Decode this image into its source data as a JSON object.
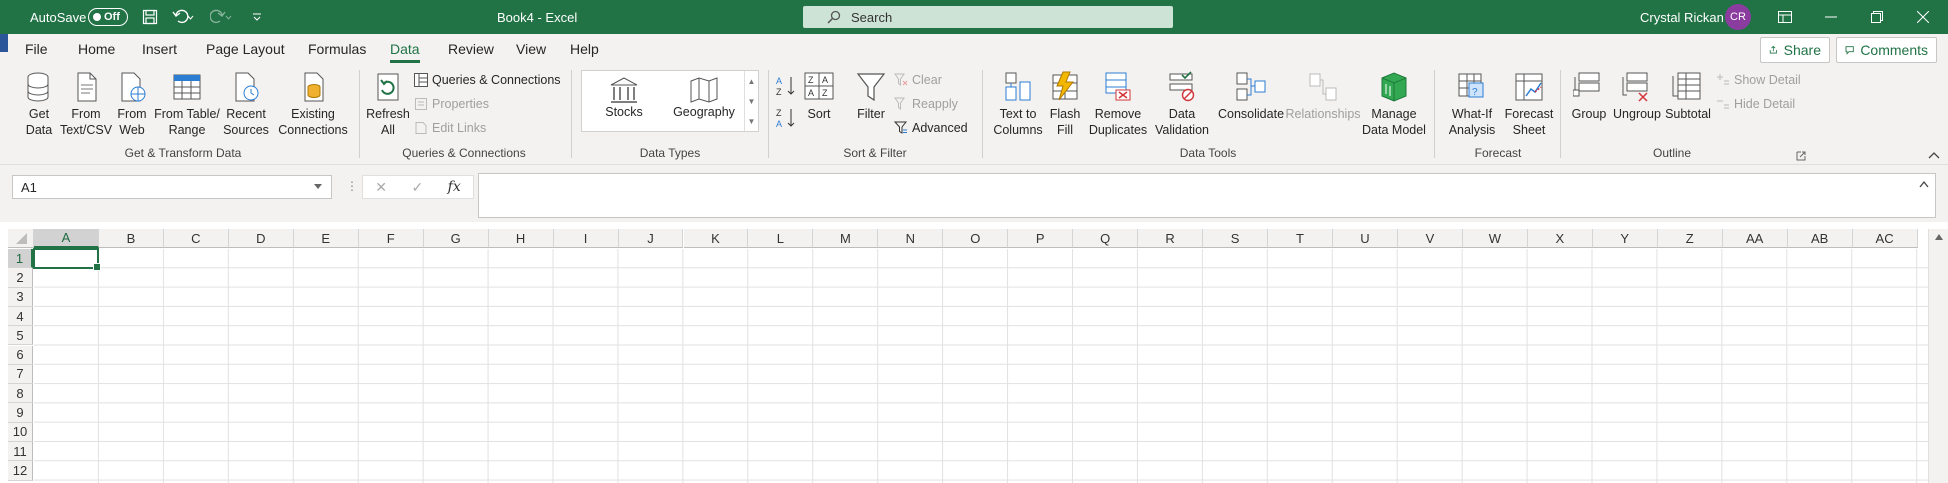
{
  "titlebar": {
    "autosave_label": "AutoSave",
    "autosave_state": "Off",
    "doc_title": "Book4  -  Excel",
    "search_placeholder": "Search",
    "user_name": "Crystal Rickan",
    "user_initials": "CR"
  },
  "tabs": [
    "File",
    "Home",
    "Insert",
    "Page Layout",
    "Formulas",
    "Data",
    "Review",
    "View",
    "Help"
  ],
  "active_tab": "Data",
  "top_buttons": {
    "share": "Share",
    "comments": "Comments"
  },
  "ribbon": {
    "get_transform": {
      "label": "Get & Transform Data",
      "get_data": [
        "Get",
        "Data"
      ],
      "from_text": [
        "From",
        "Text/CSV"
      ],
      "from_web": [
        "From",
        "Web"
      ],
      "from_table": [
        "From Table/",
        "Range"
      ],
      "recent_sources": [
        "Recent",
        "Sources"
      ],
      "existing_connections": [
        "Existing",
        "Connections"
      ]
    },
    "queries": {
      "label": "Queries & Connections",
      "refresh_all": [
        "Refresh",
        "All"
      ],
      "queries_connections": "Queries & Connections",
      "properties": "Properties",
      "edit_links": "Edit Links"
    },
    "data_types": {
      "label": "Data Types",
      "stocks": "Stocks",
      "geography": "Geography"
    },
    "sort_filter": {
      "label": "Sort & Filter",
      "sort": "Sort",
      "filter": "Filter",
      "clear": "Clear",
      "reapply": "Reapply",
      "advanced": "Advanced"
    },
    "data_tools": {
      "label": "Data Tools",
      "text_to_columns": [
        "Text to",
        "Columns"
      ],
      "flash_fill": [
        "Flash",
        "Fill"
      ],
      "remove_duplicates": [
        "Remove",
        "Duplicates"
      ],
      "data_validation": [
        "Data",
        "Validation"
      ],
      "consolidate": "Consolidate",
      "relationships": "Relationships",
      "manage_data_model": [
        "Manage",
        "Data Model"
      ]
    },
    "forecast": {
      "label": "Forecast",
      "what_if": [
        "What-If",
        "Analysis"
      ],
      "forecast_sheet": [
        "Forecast",
        "Sheet"
      ]
    },
    "outline": {
      "label": "Outline",
      "group": "Group",
      "ungroup": "Ungroup",
      "subtotal": "Subtotal",
      "show_detail": "Show Detail",
      "hide_detail": "Hide Detail"
    }
  },
  "formula_bar": {
    "name_box": "A1",
    "fx": "fx",
    "value": ""
  },
  "grid": {
    "columns": [
      "A",
      "B",
      "C",
      "D",
      "E",
      "F",
      "G",
      "H",
      "I",
      "J",
      "K",
      "L",
      "M",
      "N",
      "O",
      "P",
      "Q",
      "R",
      "S",
      "T",
      "U",
      "V",
      "W",
      "X",
      "Y",
      "Z",
      "AA",
      "AB",
      "AC"
    ],
    "rows": [
      "1",
      "2",
      "3",
      "4",
      "5",
      "6",
      "7",
      "8",
      "9",
      "10",
      "11",
      "12"
    ],
    "active_cell": "A1"
  },
  "colors": {
    "brand": "#217346",
    "accent_strip": "#2b579a",
    "avatar": "#8b3c9f"
  }
}
